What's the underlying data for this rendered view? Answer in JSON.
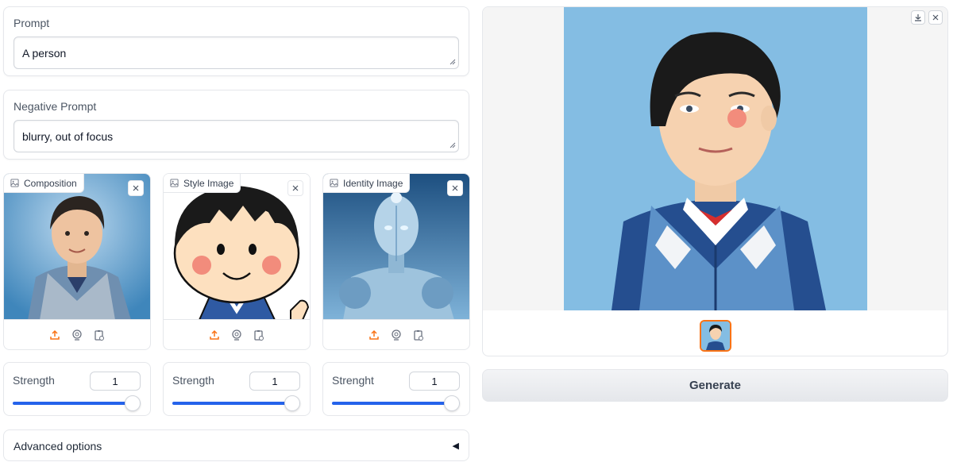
{
  "prompt": {
    "label": "Prompt",
    "value": "A person"
  },
  "negative_prompt": {
    "label": "Negative Prompt",
    "value": "blurry, out of focus"
  },
  "images": [
    {
      "label": "Composition",
      "image": "photo of boy in denim jacket"
    },
    {
      "label": "Style Image",
      "image": "cartoon boy illustration"
    },
    {
      "label": "Identity Image",
      "image": "blue robot figure"
    }
  ],
  "sliders": [
    {
      "label": "Strength",
      "value": "1"
    },
    {
      "label": "Strength",
      "value": "1"
    },
    {
      "label": "Strenght",
      "value": "1"
    }
  ],
  "advanced": {
    "label": "Advanced options",
    "caret": "◀"
  },
  "generate": {
    "label": "Generate"
  },
  "colors": {
    "accent": "#2563eb",
    "source_icon": "#f97316",
    "selected_border": "#f97316"
  },
  "icons": [
    "image-icon",
    "close-icon",
    "upload-icon",
    "webcam-icon",
    "clipboard-icon",
    "download-icon",
    "resize-grip-icon"
  ]
}
